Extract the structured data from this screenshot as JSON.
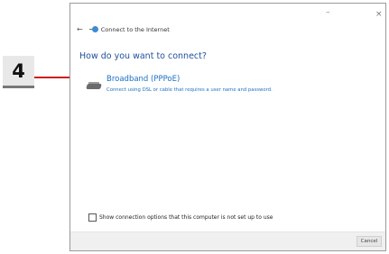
{
  "callout": {
    "number": "4"
  },
  "window": {
    "controls": {
      "minimize": "–",
      "close": "×"
    },
    "wizard_title": "Connect to the Internet",
    "heading": "How do you want to connect?",
    "option": {
      "title": "Broadband (PPPoE)",
      "description": "Connect using DSL or cable that requires a user name and password."
    },
    "checkbox": {
      "label": "Show connection options that this computer is not set up to use",
      "checked": false
    },
    "footer": {
      "cancel_label": "Cancel"
    }
  },
  "colors": {
    "callout_line": "#cc1f1f",
    "heading": "#1f4e9c",
    "link": "#1c6fc4"
  },
  "icons": {
    "back": "back-arrow-icon",
    "wizard": "globe-network-icon",
    "option": "modem-icon"
  }
}
